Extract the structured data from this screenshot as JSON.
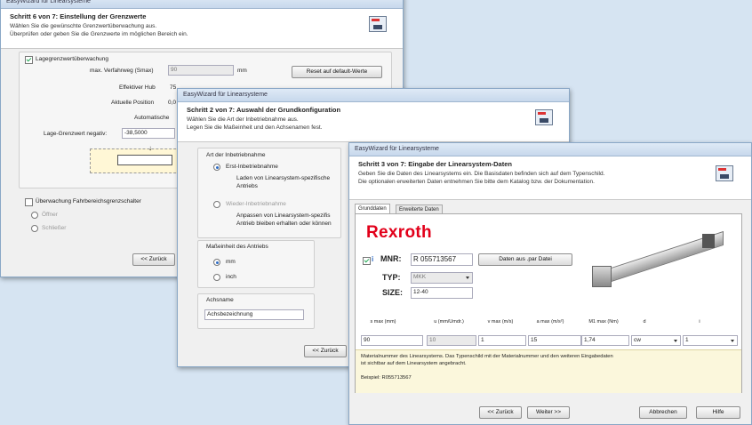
{
  "win1": {
    "title": "EasyWizard für Linearsysteme",
    "header_title": "Schritt 6 von 7: Einstellung der Grenzwerte",
    "header_line1": "Wählen Sie die gewünschte Grenzwertüberwachung aus.",
    "header_line2": "Überprüfen oder geben Sie die Grenzwerte im möglichen Bereich ein.",
    "pos_check_label": "Lagegrenzwertüberwachung",
    "max_travel_label": "max. Verfahrweg (Smax)",
    "max_travel_value": "90",
    "max_travel_unit": "mm",
    "reset_button": "Reset auf default-Werte",
    "eff_stroke_label": "Effektiver Hub",
    "eff_stroke_value": "75",
    "current_pos_label": "Aktuelle Position",
    "current_pos_value": "0,0",
    "auto_label": "Automatische",
    "neg_limit_label": "Lage-Grenzwert negativ:",
    "neg_limit_value": "-38,5000",
    "limit_switch_label": "Überwachung Fahrbereichsgrenzschalter",
    "opener_label": "Öffner",
    "closer_label": "Schließer",
    "back_button": "<< Zurück"
  },
  "win2": {
    "title": "EasyWizard für Linearsysteme",
    "header_title": "Schritt 2 von 7: Auswahl der Grundkonfiguration",
    "header_line1": "Wählen Sie die Art der Inbetriebnahme aus.",
    "header_line2": "Legen Sie die Maßeinheit und den Achsenamen fest.",
    "group1_title": "Art der Inbetriebnahme",
    "first_label": "Erst-Inbetriebnahme",
    "first_desc1": "Laden von Linearsystem-spezifische",
    "first_desc2": "Antriebs",
    "re_label": "Wieder-Inbetriebnahme",
    "re_desc1": "Anpassen von Linearsystem-spezifis",
    "re_desc2": "Antrieb bleiben erhalten oder können",
    "group2_title": "Maßeinheit des Antriebs",
    "unit_mm": "mm",
    "unit_inch": "inch",
    "group3_title": "Achsname",
    "axis_value": "Achsbezeichnung",
    "back_button": "<< Zurück"
  },
  "win3": {
    "title": "EasyWizard für Linearsysteme",
    "header_title": "Schritt 3 von 7: Eingabe der Linearsystem-Daten",
    "header_line1": "Geben Sie die Daten des Linearsystems ein. Die Basisdaten befinden sich auf dem Typenschild.",
    "header_line2": "Die optionalen erweiterten Daten entnehmen Sie bitte dem Katalog bzw. der Dokumentation.",
    "tab_basic": "Grunddaten",
    "tab_ext": "Erweiterte Daten",
    "brand": "Rexroth",
    "mnr_label": "MNR:",
    "mnr_value": "R 055713567",
    "load_button": "Daten aus .par Datei",
    "typ_label": "TYP:",
    "typ_value": "MKK",
    "size_label": "SIZE:",
    "size_value": "12-40",
    "columns": [
      "s max (mm)",
      "u (mm/Umdr.)",
      "v max (m/s)",
      "a max (m/s²)",
      "M1 max (Nm)",
      "d",
      "i"
    ],
    "values": [
      "90",
      "10",
      "1",
      "15",
      "1,74",
      "cw",
      "1"
    ],
    "info_line1": "Materialnummer des Linearsystems. Das Typenschild mit der Materialnummer und den weiteren Eingabedaten",
    "info_line2": "ist sichtbar auf dem Linearsystem angebracht.",
    "example": "Beispiel: R055713567",
    "back_button": "<< Zurück",
    "next_button": "Weiter >>",
    "cancel_button": "Abbrechen",
    "help_button": "Hilfe",
    "brand_color": "#e2001a"
  }
}
